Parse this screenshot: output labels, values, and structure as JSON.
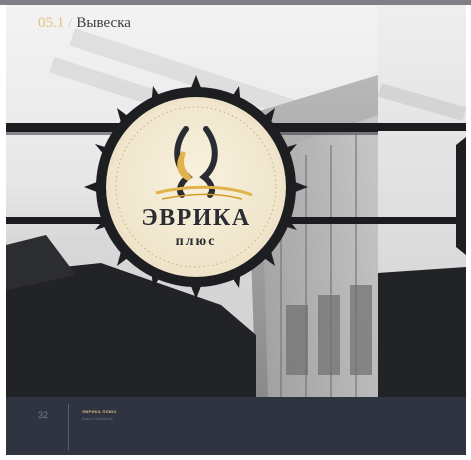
{
  "header": {
    "section_number": "05.1",
    "separator": "/",
    "section_title": "Вывеска"
  },
  "sign": {
    "logo_main": "ЭВРИКА",
    "logo_sub": "плюс"
  },
  "footer": {
    "page_number": "32",
    "brand_name": "ЭВРИКА ПЛЮС",
    "brand_subtitle": "Brand Guidelines"
  },
  "colors": {
    "accent_gold": "#e1c37c",
    "footer_bg": "#2f3440",
    "sign_face": "#f4ecd7",
    "sign_edge": "#1d1e22",
    "logo_text": "#2a2c33"
  }
}
